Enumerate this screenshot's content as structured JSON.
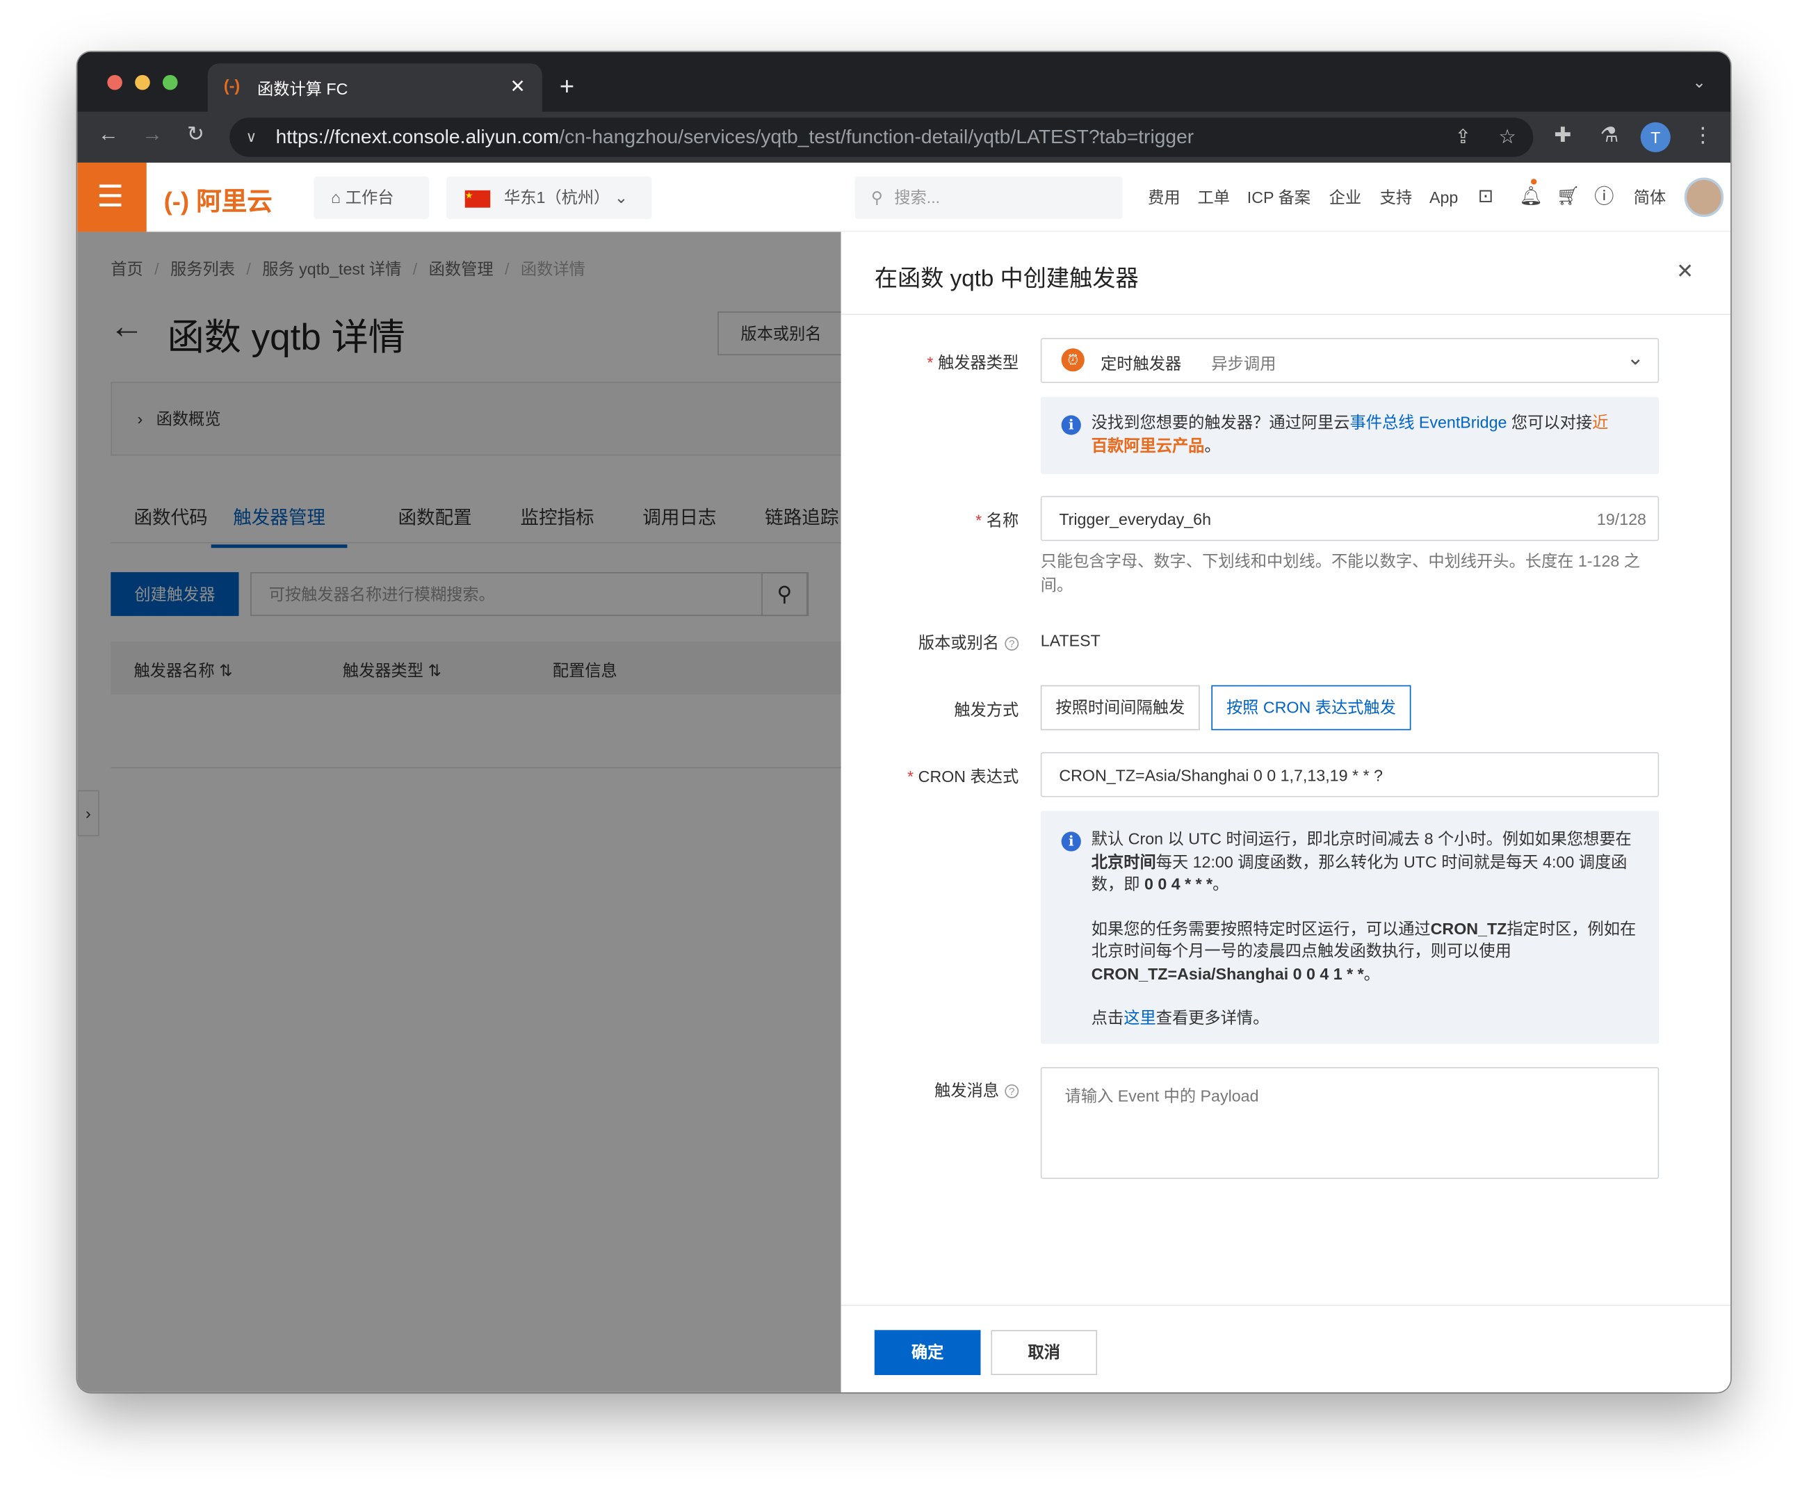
{
  "browser": {
    "tab_title": "函数计算 FC",
    "url_host": "https://fcnext.console.aliyun.com",
    "url_path": "/cn-hangzhou/services/yqtb_test/function-detail/yqtb/LATEST?tab=trigger",
    "avatar_letter": "T"
  },
  "topbar": {
    "logo": "阿里云",
    "workbench": "工作台",
    "region": "华东1（杭州）",
    "search_placeholder": "搜索...",
    "nav": [
      "费用",
      "工单",
      "ICP 备案",
      "企业",
      "支持",
      "App"
    ],
    "lang": "简体"
  },
  "page": {
    "breadcrumb": [
      "首页",
      "服务列表",
      "服务 yqtb_test 详情",
      "函数管理",
      "函数详情"
    ],
    "title": "函数 yqtb 详情",
    "version_button": "版本或别名",
    "overview": "函数概览",
    "tabs": [
      "函数代码",
      "触发器管理",
      "函数配置",
      "监控指标",
      "调用日志",
      "链路追踪"
    ],
    "active_tab": 1,
    "create_button": "创建触发器",
    "search_placeholder": "可按触发器名称进行模糊搜索。",
    "columns": [
      "触发器名称",
      "触发器类型",
      "配置信息"
    ]
  },
  "drawer": {
    "title": "在函数 yqtb 中创建触发器",
    "trigger_type_label": "触发器类型",
    "trigger_type": "定时触发器",
    "trigger_type_sub": "异步调用",
    "tip1_a": "没找到您想要的触发器？通过阿里云",
    "tip1_link": "事件总线 EventBridge",
    "tip1_b": " 您可以对接",
    "tip1_link2a": "近",
    "tip1_link2b": "百款阿里云产品",
    "tip1_c": "。",
    "name_label": "名称",
    "name_value": "Trigger_everyday_6h",
    "name_count": "19/128",
    "name_help": "只能包含字母、数字、下划线和中划线。不能以数字、中划线开头。长度在 1-128 之间。",
    "version_label": "版本或别名",
    "version_value": "LATEST",
    "mode_label": "触发方式",
    "mode_options": [
      "按照时间间隔触发",
      "按照 CRON 表达式触发"
    ],
    "mode_selected": 1,
    "cron_label": "CRON 表达式",
    "cron_value": "CRON_TZ=Asia/Shanghai 0 0 1,7,13,19 * * ?",
    "tip2": {
      "p1a": "默认 Cron 以 UTC 时间运行，即北京时间减去 8 个小时。例如如果您想要在",
      "p1b": "北京时间",
      "p1c": "每天 12:00 调度函数，那么转化为 UTC 时间就是每天 4:00 调度函数，即 ",
      "p1d": "0 0 4 * * *",
      "p1e": "。",
      "p2a": "如果您的任务需要按照特定时区运行，可以通过",
      "p2b": "CRON_TZ",
      "p2c": "指定时区，例如在北京时间每个月一号的凌晨四点触发函数执行，则可以使用 ",
      "p2d": "CRON_TZ=Asia/Shanghai 0 0 4 1 * *",
      "p2e": "。",
      "p3a": "点击",
      "p3link": "这里",
      "p3b": "查看更多详情。"
    },
    "payload_label": "触发消息",
    "payload_placeholder": "请输入 Event 中的 Payload",
    "ok": "确定",
    "cancel": "取消"
  },
  "colors": {
    "brand": "#e86b1e",
    "primary": "#0064c8"
  }
}
